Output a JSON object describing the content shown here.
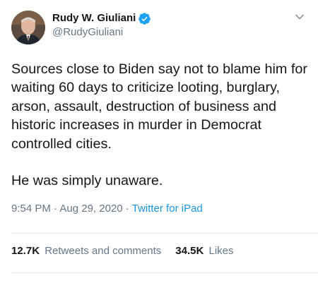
{
  "author": {
    "display_name": "Rudy W. Giuliani",
    "handle": "@RudyGiuliani",
    "verified": true
  },
  "icons": {
    "verified": "verified-badge-icon",
    "menu": "chevron-down-icon"
  },
  "tweet": {
    "paragraphs": [
      "Sources close to Biden say not to blame him for waiting 60 days to criticize looting, burglary, arson, assault, destruction of business and historic increases in murder in Democrat controlled cities.",
      "He was simply unaware."
    ],
    "time": "9:54 PM",
    "date": "Aug 29, 2020",
    "separator": "·",
    "source": "Twitter for iPad"
  },
  "stats": {
    "retweets_count": "12.7K",
    "retweets_label": "Retweets and comments",
    "likes_count": "34.5K",
    "likes_label": "Likes"
  },
  "colors": {
    "text": "#14171a",
    "secondary": "#657786",
    "link": "#1b95e0",
    "verified": "#1da1f2",
    "divider": "#e6ecf0"
  }
}
